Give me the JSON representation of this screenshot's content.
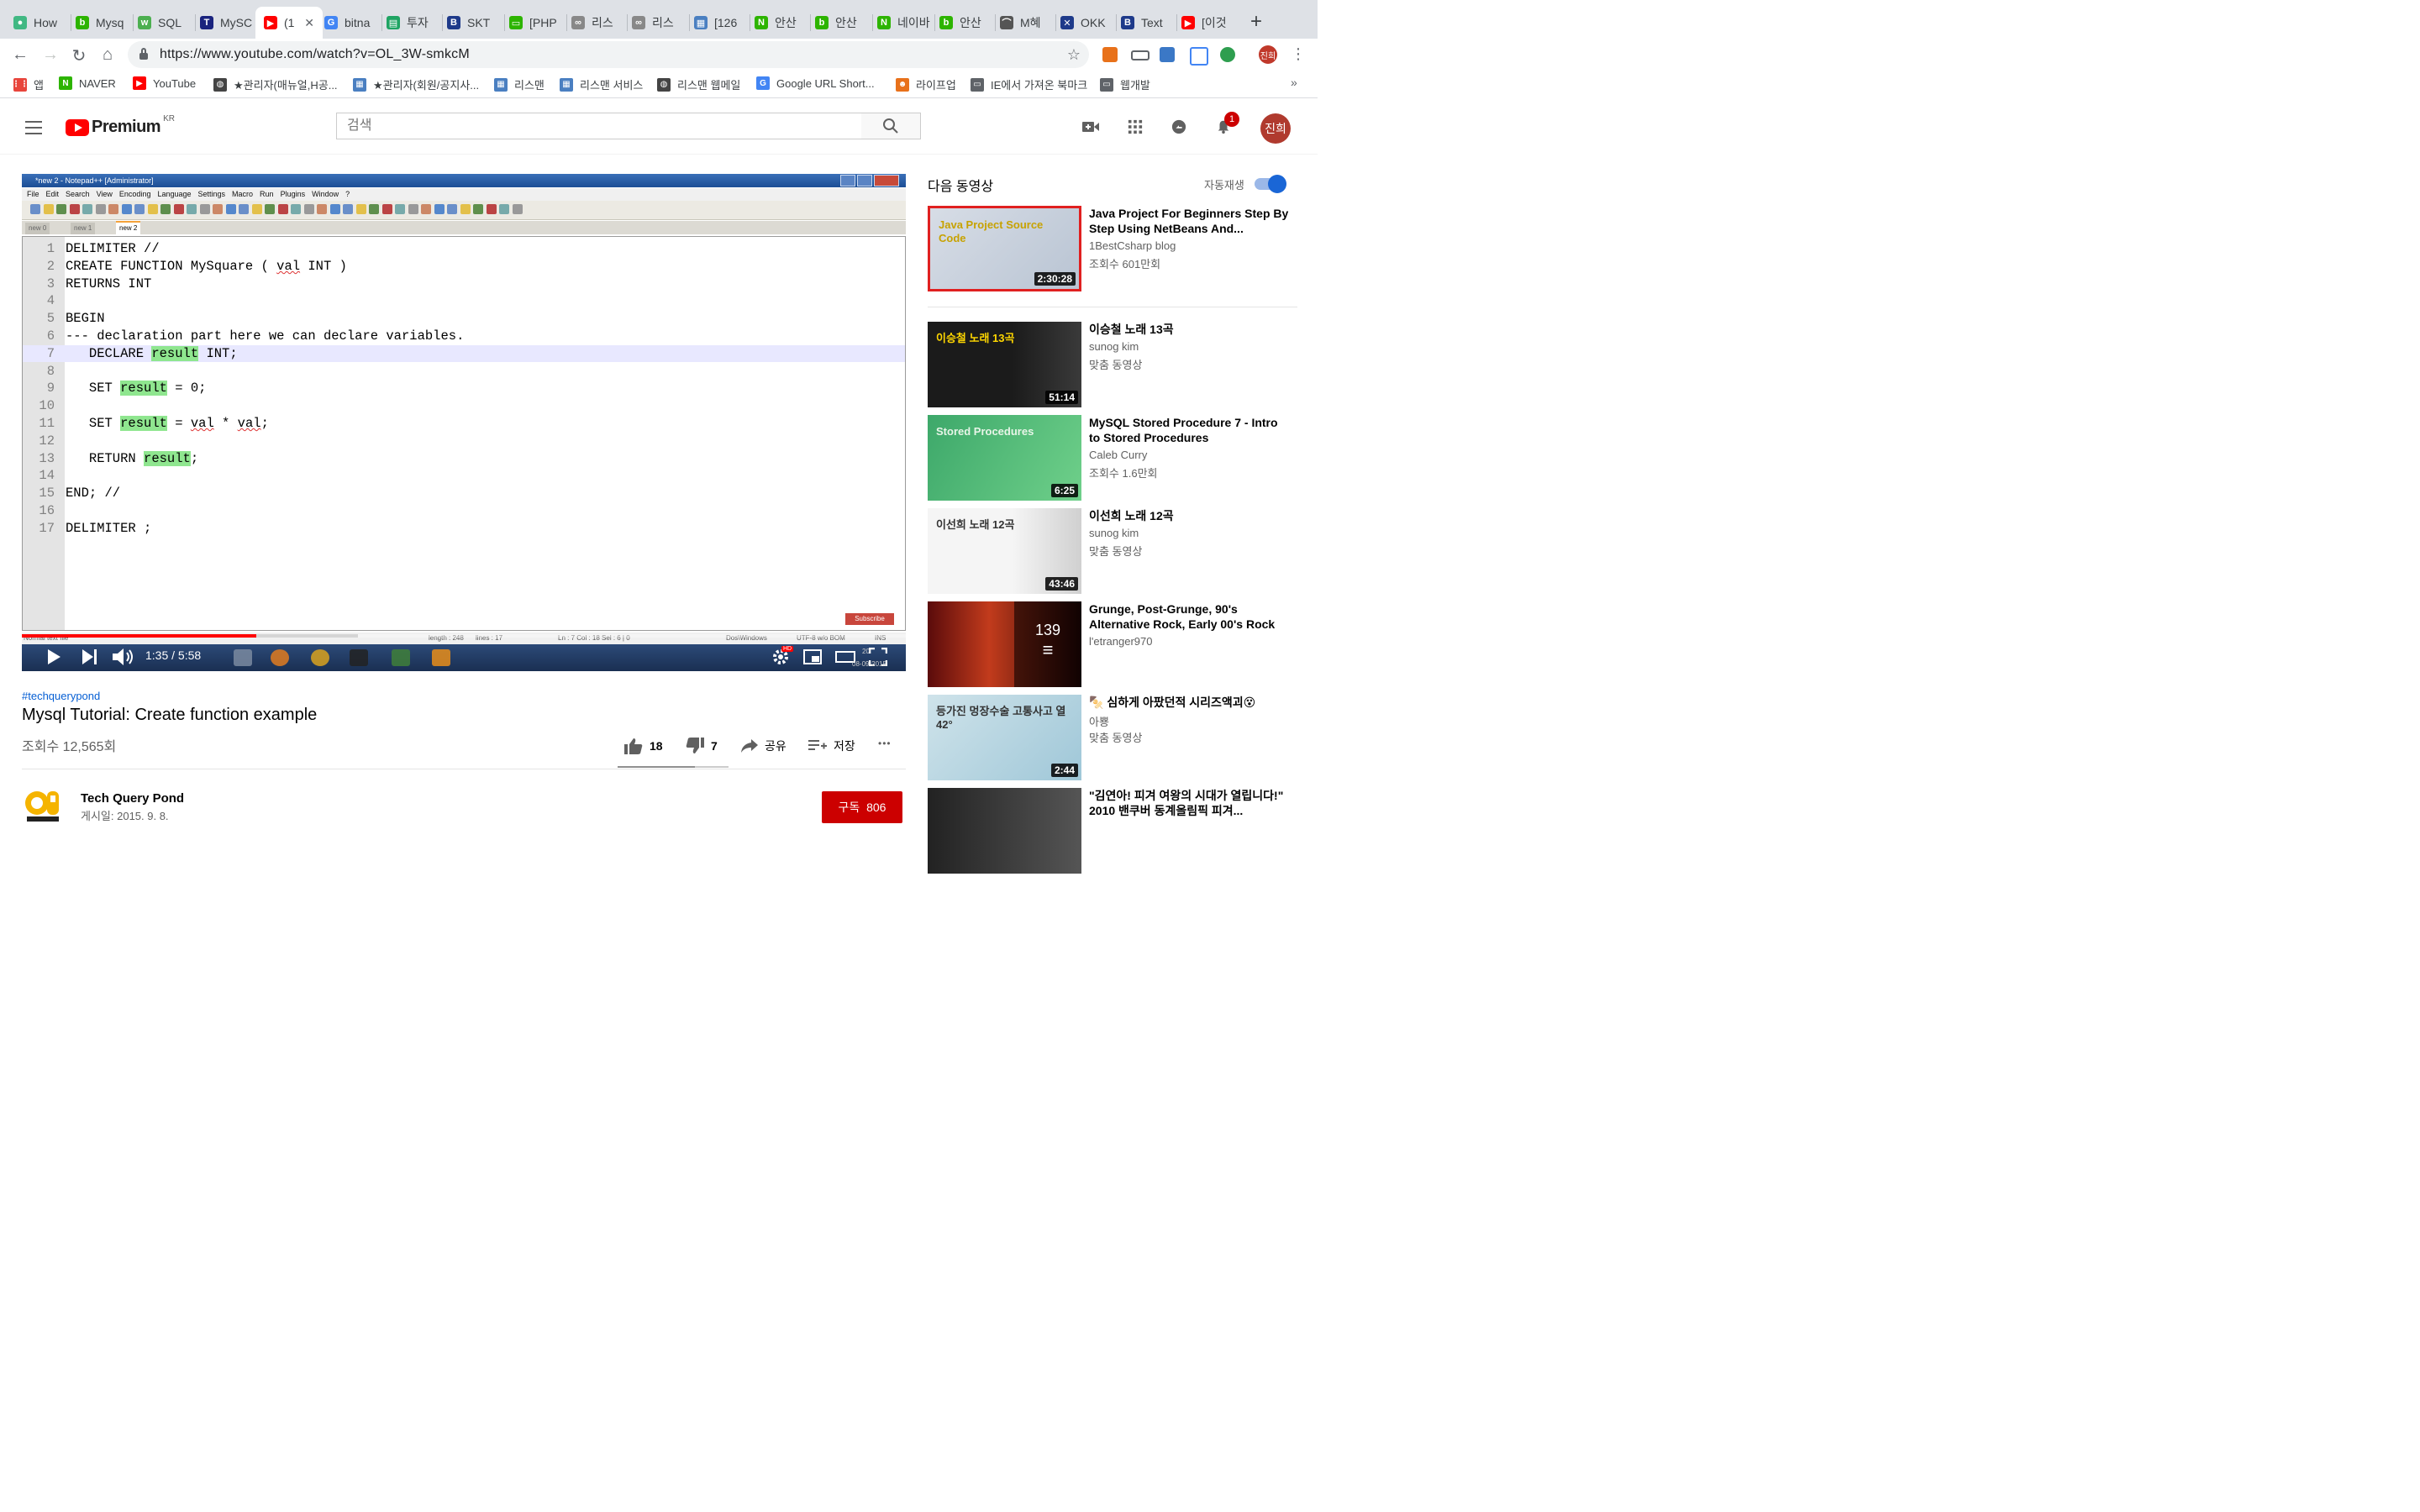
{
  "browser": {
    "tabs": [
      {
        "label": "How",
        "color": "#41b883",
        "glyph": "●"
      },
      {
        "label": "Mysq",
        "color": "#2db400",
        "glyph": "b"
      },
      {
        "label": "SQL",
        "color": "#4caf50",
        "glyph": "w"
      },
      {
        "label": "MySC",
        "color": "#1a237e",
        "glyph": "T"
      },
      {
        "label": "(1",
        "color": "#ff0000",
        "glyph": "▶",
        "active": true
      },
      {
        "label": "bitna",
        "color": "#4285f4",
        "glyph": "G"
      },
      {
        "label": "투자",
        "color": "#1fa463",
        "glyph": "▤"
      },
      {
        "label": "SKT",
        "color": "#1e3a8a",
        "glyph": "B"
      },
      {
        "label": "[PHP",
        "color": "#2db400",
        "glyph": "▭"
      },
      {
        "label": "리스",
        "color": "#888888",
        "glyph": "∞"
      },
      {
        "label": "리스",
        "color": "#888888",
        "glyph": "∞"
      },
      {
        "label": "[126",
        "color": "#4a7fc1",
        "glyph": "▦"
      },
      {
        "label": "안산",
        "color": "#2db400",
        "glyph": "N"
      },
      {
        "label": "안산",
        "color": "#2db400",
        "glyph": "b"
      },
      {
        "label": "네이바",
        "color": "#2db400",
        "glyph": "N"
      },
      {
        "label": "안산",
        "color": "#2db400",
        "glyph": "b"
      },
      {
        "label": "M혜",
        "color": "#555555",
        "glyph": "⌒"
      },
      {
        "label": "OKK",
        "color": "#1e3a8a",
        "glyph": "✕"
      },
      {
        "label": "Text",
        "color": "#1e3a8a",
        "glyph": "B"
      },
      {
        "label": "[이것",
        "color": "#ff0000",
        "glyph": "▶"
      }
    ],
    "url": "https://www.youtube.com/watch?v=OL_3W-smkcM",
    "profile_initials": "진희",
    "bookmarks": [
      {
        "label": "앱",
        "color": "#e8453c",
        "glyph": "⋮⋮"
      },
      {
        "label": "NAVER",
        "color": "#2db400",
        "glyph": "N"
      },
      {
        "label": "YouTube",
        "color": "#ff0000",
        "glyph": "▶"
      },
      {
        "label": "★관리자(매뉴얼,H공...",
        "color": "#444444",
        "glyph": "◍"
      },
      {
        "label": "★관리자(회원/공지사...",
        "color": "#4a7fc1",
        "glyph": "▦"
      },
      {
        "label": "리스맨",
        "color": "#4a7fc1",
        "glyph": "▦"
      },
      {
        "label": "리스맨 서비스",
        "color": "#4a7fc1",
        "glyph": "▦"
      },
      {
        "label": "리스맨 웹메일",
        "color": "#444444",
        "glyph": "◍"
      },
      {
        "label": "Google URL Short...",
        "color": "#4285f4",
        "glyph": "G"
      },
      {
        "label": "라이프업",
        "color": "#e8711a",
        "glyph": "☻"
      },
      {
        "label": "IE에서 가져온 북마크",
        "color": "#5f6368",
        "glyph": "▭"
      },
      {
        "label": "웹개발",
        "color": "#5f6368",
        "glyph": "▭"
      }
    ],
    "bookmarks_more": "»"
  },
  "youtube": {
    "logo_text": "Premium",
    "logo_region": "KR",
    "search_placeholder": "검색",
    "notification_count": "1",
    "avatar_initials": "진희"
  },
  "video": {
    "notepad": {
      "title": "*new 2 - Notepad++ [Administrator]",
      "menu": [
        "File",
        "Edit",
        "Search",
        "View",
        "Encoding",
        "Language",
        "Settings",
        "Macro",
        "Run",
        "Plugins",
        "Window",
        "?"
      ],
      "tabs": [
        "new 0",
        "new 1",
        "new 2"
      ],
      "code": [
        {
          "n": "1",
          "t": "DELIMITER //"
        },
        {
          "n": "2",
          "t": "CREATE FUNCTION MySquare ( val INT )"
        },
        {
          "n": "3",
          "t": "RETURNS INT"
        },
        {
          "n": "4",
          "t": ""
        },
        {
          "n": "5",
          "t": "BEGIN"
        },
        {
          "n": "6",
          "t": "--- declaration part here we can declare variables."
        },
        {
          "n": "7",
          "t": "   DECLARE result INT;"
        },
        {
          "n": "8",
          "t": ""
        },
        {
          "n": "9",
          "t": "   SET result = 0;"
        },
        {
          "n": "10",
          "t": ""
        },
        {
          "n": "11",
          "t": "   SET result = val * val;"
        },
        {
          "n": "12",
          "t": ""
        },
        {
          "n": "13",
          "t": "   RETURN result;"
        },
        {
          "n": "14",
          "t": ""
        },
        {
          "n": "15",
          "t": "END; //"
        },
        {
          "n": "16",
          "t": ""
        },
        {
          "n": "17",
          "t": "DELIMITER ;"
        }
      ],
      "status": {
        "file_type": "Normal text file",
        "length": "length : 248",
        "lines": "lines : 17",
        "position": "Ln : 7    Col : 18    Sel : 6 | 0",
        "eol": "Dos\\Windows",
        "encoding": "UTF-8 w/o BOM",
        "mode": "INS"
      },
      "subscribe_overlay": "Subscribe",
      "clock_time": "20:",
      "clock_date": "08-09-2015"
    },
    "time_current": "1:35",
    "time_total": "5:58",
    "progress_fraction": 0.265,
    "hd_badge": "HD",
    "hashtag": "#techquerypond",
    "title": "Mysql Tutorial: Create function example",
    "views": "조회수 12,565회",
    "likes": "18",
    "dislikes": "7",
    "share_label": "공유",
    "save_label": "저장",
    "more": "•••",
    "channel_name": "Tech Query Pond",
    "published": "게시일: 2015. 9. 8.",
    "subscribe_label": "구독",
    "subscriber_count": "806"
  },
  "sidebar": {
    "up_next_label": "다음 동영상",
    "autoplay_label": "자동재생",
    "recommendations": [
      {
        "title": "Java Project For Beginners Step By Step Using NetBeans And...",
        "channel": "1BestCsharp blog",
        "meta": "조회수 601만회",
        "duration": "2:30:28",
        "thumb_text": "Java Project Source Code"
      },
      {
        "title": "이승철 노래 13곡",
        "channel": "sunog kim",
        "meta": "맞춤 동영상",
        "duration": "51:14",
        "thumb_text": "이승철 노래 13곡"
      },
      {
        "title": "MySQL Stored Procedure 7 - Intro to Stored Procedures",
        "channel": "Caleb Curry",
        "meta": "조회수 1.6만회",
        "duration": "6:25",
        "thumb_text": "Stored Procedures"
      },
      {
        "title": "이선희 노래 12곡",
        "channel": "sunog kim",
        "meta": "맞춤 동영상",
        "duration": "43:46",
        "thumb_text": "이선희 노래 12곡"
      },
      {
        "title": "Grunge, Post-Grunge, 90's Alternative Rock, Early 00's Rock",
        "channel": "l'etranger970",
        "meta": "",
        "duration": "",
        "playlist_count": "139"
      },
      {
        "title": "🍢 심하게 아팠던적 시리즈액괴😵",
        "channel": "아뿅",
        "meta": "맞춤 동영상",
        "duration": "2:44",
        "thumb_text": "등가진 멍장수술 고통사고 열 42°"
      },
      {
        "title": "\"김연아! 피겨 여왕의 시대가 열립니다!\" 2010 밴쿠버 동계올림픽 피겨...",
        "channel": "",
        "meta": "",
        "duration": ""
      }
    ]
  }
}
